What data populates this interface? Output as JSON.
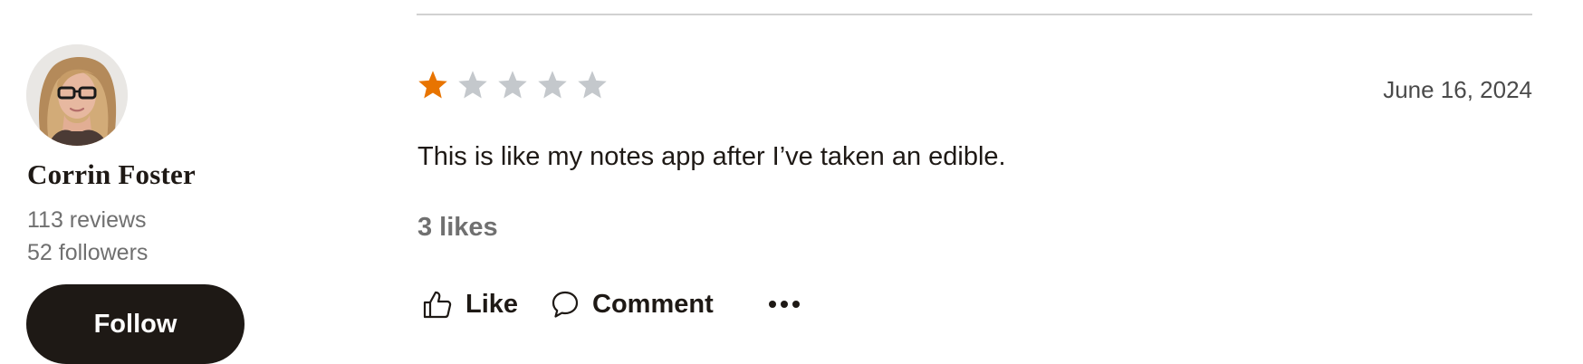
{
  "reviewer": {
    "name": "Corrin Foster",
    "reviews": "113 reviews",
    "followers": "52 followers",
    "follow_label": "Follow",
    "avatar_icon": "avatar-photo"
  },
  "review": {
    "rating": 1,
    "rating_max": 5,
    "date": "June 16, 2024",
    "text": "This is like my notes app after I’ve taken an edible.",
    "likes": "3 likes"
  },
  "actions": {
    "like_label": "Like",
    "comment_label": "Comment",
    "like_icon": "thumbs-up-icon",
    "comment_icon": "speech-bubble-icon",
    "more_icon": "more-dots-icon"
  },
  "colors": {
    "star_filled": "#e87400",
    "star_empty": "#c4c8cc",
    "button_bg": "#1e1915",
    "text_primary": "#1e1915",
    "text_secondary": "#707070"
  }
}
